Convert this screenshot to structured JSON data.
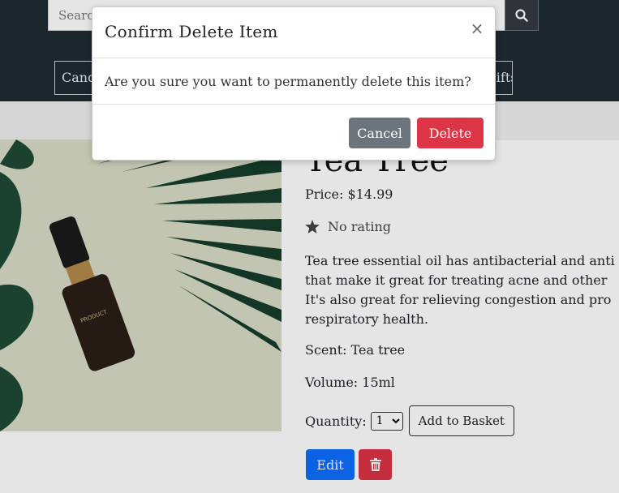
{
  "header": {
    "search_placeholder": "Search",
    "nav_left_label": "Candles",
    "nav_right_label": "Gifts"
  },
  "product": {
    "name": "Tea Tree",
    "price": "Price: $14.99",
    "rating": "No rating",
    "description_lines": [
      "Tea tree essential oil has antibacterial and anti",
      "that make it great for treating acne and other",
      "It's also great for relieving congestion and pro",
      "respiratory health."
    ],
    "scent": "Scent: Tea tree",
    "volume": "Volume: 15ml",
    "quantity_label": "Quantity:",
    "quantity_value": "1",
    "add_to_basket_label": "Add to Basket",
    "edit_label": "Edit",
    "image_icon": "essential-oil-bottle-photo"
  },
  "modal": {
    "title": "Confirm Delete Item",
    "close_symbol": "×",
    "message": "Are you sure you want to permanently delete this item?",
    "cancel_label": "Cancel",
    "delete_label": "Delete"
  },
  "colors": {
    "header_bg": "#1f2b33",
    "primary": "#0d6efd",
    "danger": "#dc3545",
    "secondary": "#6c757d"
  },
  "icons": {
    "search": "search-icon",
    "star": "star-icon",
    "trash": "trash-icon",
    "close": "close-icon"
  }
}
